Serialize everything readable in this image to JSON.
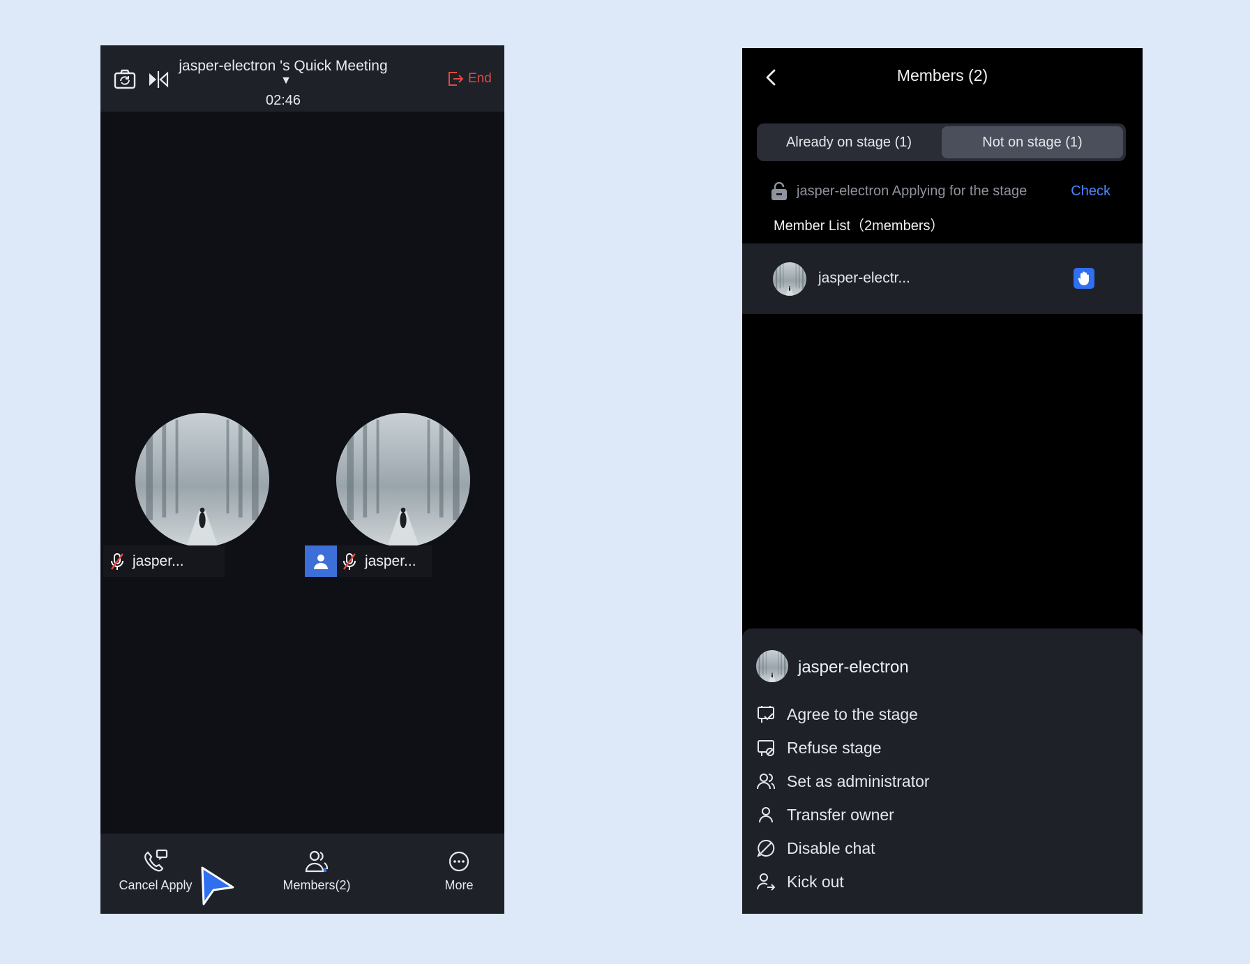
{
  "meeting": {
    "title": "jasper-electron 's Quick Meeting",
    "timer": "02:46",
    "end_label": "End",
    "participants": [
      {
        "name": "jasper..."
      },
      {
        "name": "jasper..."
      }
    ],
    "bottom_bar": {
      "cancel_apply": "Cancel Apply",
      "members": "Members(2)",
      "more": "More"
    }
  },
  "members_panel": {
    "title": "Members (2)",
    "tabs": {
      "on_stage": "Already on stage (1)",
      "not_on_stage": "Not on stage (1)",
      "selected": "Not on stage (1)"
    },
    "apply_notice": "jasper-electron Applying for the stage",
    "check_label": "Check",
    "member_list_title": "Member List（2members）",
    "members": [
      {
        "name": "jasper-electr..."
      }
    ],
    "action_sheet": {
      "name": "jasper-electron",
      "actions": [
        "Agree to the stage",
        "Refuse stage",
        "Set as administrator",
        "Transfer owner",
        "Disable chat",
        "Kick out"
      ]
    }
  },
  "colors": {
    "page_background": "#dde9f8",
    "end_red": "#e5483f",
    "accent_blue": "#4a86ff",
    "badge_blue": "#2f6ff0"
  }
}
